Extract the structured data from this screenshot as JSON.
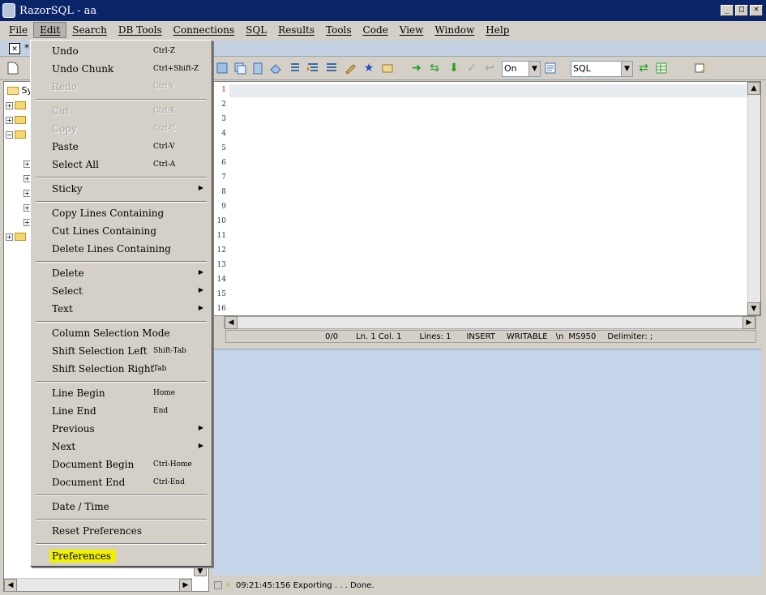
{
  "window": {
    "title": "RazorSQL - aa",
    "min_label": "_",
    "max_label": "□",
    "close_label": "✕"
  },
  "menubar": {
    "items": [
      "File",
      "Edit",
      "Search",
      "DB Tools",
      "Connections",
      "SQL",
      "Results",
      "Tools",
      "Code",
      "View",
      "Window",
      "Help"
    ],
    "active": "Edit"
  },
  "tabstrip": {
    "close_label": "✕",
    "tab_label": "*"
  },
  "toolbar": {
    "autocommit_value": "On",
    "language_value": "SQL"
  },
  "tree": {
    "root_label": "Sy"
  },
  "edit_menu": {
    "undo": {
      "label": "Undo",
      "shortcut": "Ctrl-Z"
    },
    "undo_chunk": {
      "label": "Undo Chunk",
      "shortcut": "Ctrl+Shift-Z"
    },
    "redo": {
      "label": "Redo",
      "shortcut": "Ctrl-Y"
    },
    "cut": {
      "label": "Cut",
      "shortcut": "Ctrl-X"
    },
    "copy": {
      "label": "Copy",
      "shortcut": "Ctrl-C"
    },
    "paste": {
      "label": "Paste",
      "shortcut": "Ctrl-V"
    },
    "select_all": {
      "label": "Select All",
      "shortcut": "Ctrl-A"
    },
    "sticky": {
      "label": "Sticky"
    },
    "copy_lines": {
      "label": "Copy Lines Containing"
    },
    "cut_lines": {
      "label": "Cut Lines Containing"
    },
    "delete_lines": {
      "label": "Delete Lines Containing"
    },
    "delete": {
      "label": "Delete"
    },
    "select": {
      "label": "Select"
    },
    "text": {
      "label": "Text"
    },
    "column_selection": {
      "label": "Column Selection Mode"
    },
    "shift_left": {
      "label": "Shift Selection Left",
      "shortcut": "Shift-Tab"
    },
    "shift_right": {
      "label": "Shift Selection Right",
      "shortcut": "Tab"
    },
    "line_begin": {
      "label": "Line Begin",
      "shortcut": "Home"
    },
    "line_end": {
      "label": "Line End",
      "shortcut": "End"
    },
    "previous": {
      "label": "Previous"
    },
    "next": {
      "label": "Next"
    },
    "doc_begin": {
      "label": "Document Begin",
      "shortcut": "Ctrl-Home"
    },
    "doc_end": {
      "label": "Document End",
      "shortcut": "Ctrl-End"
    },
    "date_time": {
      "label": "Date / Time"
    },
    "reset_prefs": {
      "label": "Reset Preferences"
    },
    "preferences": {
      "label": "Preferences"
    }
  },
  "editor": {
    "line_numbers": [
      "1",
      "2",
      "3",
      "4",
      "5",
      "6",
      "7",
      "8",
      "9",
      "10",
      "11",
      "12",
      "13",
      "14",
      "15",
      "16"
    ],
    "current_line": 1
  },
  "editor_status": {
    "position": "0/0",
    "line_col": "Ln. 1 Col. 1",
    "lines": "Lines: 1",
    "mode": "INSERT",
    "writable": "WRITABLE",
    "line_ending": "\\n",
    "encoding": "MS950",
    "delimiter": "Delimiter: ;"
  },
  "bottom_status": {
    "message": "09:21:45:156 Exporting . . . Done."
  },
  "colors": {
    "title_bar": "#0a246a",
    "results_bg": "#c5d5ea",
    "highlight": "#f0f000",
    "current_line_number": "#e00000"
  }
}
